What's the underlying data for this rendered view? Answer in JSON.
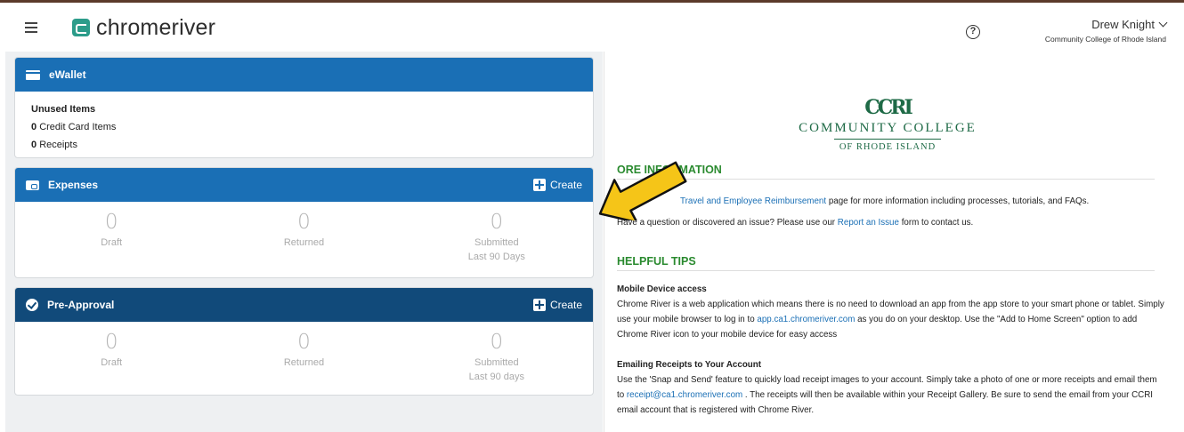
{
  "header": {
    "logo_text": "chromeriver",
    "user_name": "Drew Knight",
    "user_org": "Community College of Rhode Island"
  },
  "ewallet": {
    "title": "eWallet",
    "unused_title": "Unused Items",
    "credit_count": "0",
    "credit_label": "Credit Card Items",
    "receipts_count": "0",
    "receipts_label": "Receipts"
  },
  "expenses": {
    "title": "Expenses",
    "create_label": "Create",
    "stats": [
      {
        "value": "0",
        "label": "Draft",
        "sub": ""
      },
      {
        "value": "0",
        "label": "Returned",
        "sub": ""
      },
      {
        "value": "0",
        "label": "Submitted",
        "sub": "Last 90 Days"
      }
    ]
  },
  "preapproval": {
    "title": "Pre-Approval",
    "create_label": "Create",
    "stats": [
      {
        "value": "0",
        "label": "Draft",
        "sub": ""
      },
      {
        "value": "0",
        "label": "Returned",
        "sub": ""
      },
      {
        "value": "0",
        "label": "Submitted",
        "sub": "Last 90 days"
      }
    ]
  },
  "college": {
    "mark": "CCRI",
    "name": "COMMUNITY COLLEGE",
    "sub": "OF RHODE ISLAND"
  },
  "more_info": {
    "title": "ORE INFORMATION",
    "line1_link": "Travel and Employee Reimbursement",
    "line1_text": " page for more information including processes, tutorials, and FAQs.",
    "line2_a": "Have a question or discovered an issue? Please use our ",
    "line2_link": "Report an Issue",
    "line2_b": " form to contact us."
  },
  "tips": {
    "title": "HELPFUL TIPS",
    "mobile_title": "Mobile Device access",
    "mobile_a": "Chrome River is a web application which means there is no need to download an app from the app store to your smart phone or tablet. Simply use your mobile browser to log in to ",
    "mobile_link": "app.ca1.chromeriver.com",
    "mobile_b": " as you do on your desktop. Use the \"Add to Home Screen\" option to add Chrome River icon to your mobile device for easy access",
    "email_title": "Emailing Receipts to Your Account",
    "email_a": "Use the 'Snap and Send' feature to quickly load receipt images to your account. Simply take a photo of one or more receipts and email them to ",
    "email_link": "receipt@ca1.chromeriver.com",
    "email_b": " . The receipts will then be available within your Receipt Gallery.  Be sure to send the email from your CCRI email account that is registered with Chrome River."
  },
  "colors": {
    "accent_blue": "#1a6fb5",
    "navy": "#114a7a",
    "brand_teal": "#2c9c8a",
    "heading_green": "#2a8a2f",
    "arrow_yellow": "#f5c518"
  }
}
